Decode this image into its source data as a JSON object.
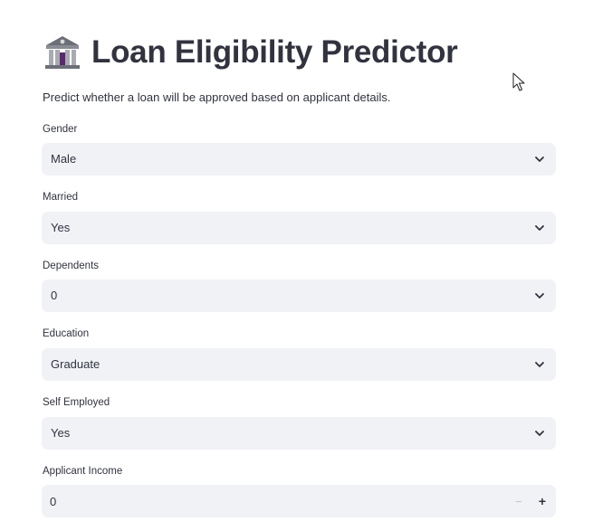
{
  "header": {
    "icon": "bank-building-icon",
    "title": "Loan Eligibility Predictor",
    "subtitle": "Predict whether a loan will be approved based on applicant details."
  },
  "form": {
    "gender": {
      "label": "Gender",
      "value": "Male"
    },
    "married": {
      "label": "Married",
      "value": "Yes"
    },
    "dependents": {
      "label": "Dependents",
      "value": "0"
    },
    "education": {
      "label": "Education",
      "value": "Graduate"
    },
    "self_employed": {
      "label": "Self Employed",
      "value": "Yes"
    },
    "applicant_income": {
      "label": "Applicant Income",
      "value": "0",
      "minus": "−",
      "plus": "+"
    }
  },
  "colors": {
    "input_bg": "#f0f2f6",
    "text": "#31333f"
  }
}
